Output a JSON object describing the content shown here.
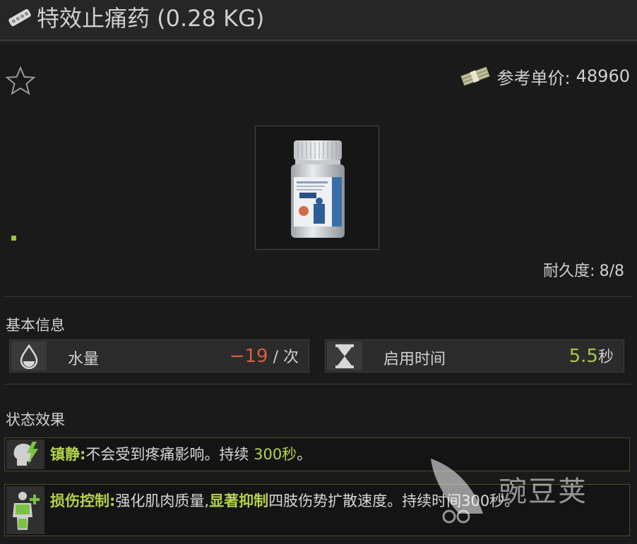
{
  "header": {
    "title": "特效止痛药 (0.28 KG)",
    "icon": "pill-strip-icon"
  },
  "item": {
    "price_label": "参考单价:",
    "price_value": "48960",
    "price_icon": "money-stack-icon",
    "durability_label": "耐久度:",
    "durability_value": "8/8",
    "image": "pill-bottle"
  },
  "basic_info": {
    "title": "基本信息",
    "stats": [
      {
        "icon": "water-drop-icon",
        "label": "水量",
        "value": "−19",
        "unit": " / 次",
        "value_color": "#d6603a"
      },
      {
        "icon": "hourglass-icon",
        "label": "启用时间",
        "value": "5.5",
        "unit": "秒",
        "value_color": "#a5c74a"
      }
    ]
  },
  "status_effects": {
    "title": "状态效果",
    "effects": [
      {
        "icon": "painkiller-head-icon",
        "name": "镇静:",
        "text_before": "不会受到疼痛影响。持续 ",
        "highlight": "300秒",
        "text_after": "。"
      },
      {
        "icon": "body-heal-icon",
        "name": "损伤控制:",
        "text_before": "强化肌肉质量,",
        "highlight": "显著抑制",
        "text_after": "四肢伤势扩散速度。持续时间300秒。"
      }
    ]
  },
  "watermark": {
    "text": "豌豆荚"
  },
  "colors": {
    "accent_green": "#b4d34a",
    "negative_red": "#d6603a",
    "panel_bg": "#1a1a1a"
  }
}
